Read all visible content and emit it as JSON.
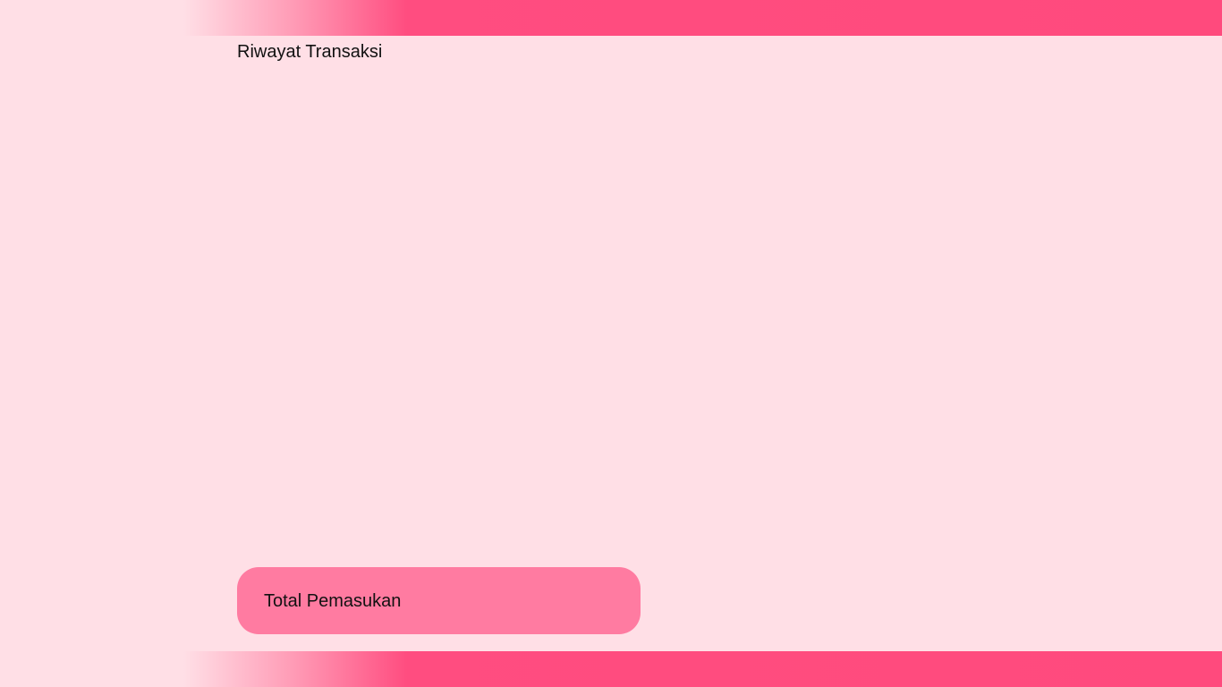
{
  "header": {
    "accent_color": "#FF4A7D"
  },
  "main": {
    "title": "Riwayat Transaksi"
  },
  "summary": {
    "label": "Total Pemasukan",
    "card_color": "#FF7BA1"
  },
  "background_color": "#FFDFE6"
}
